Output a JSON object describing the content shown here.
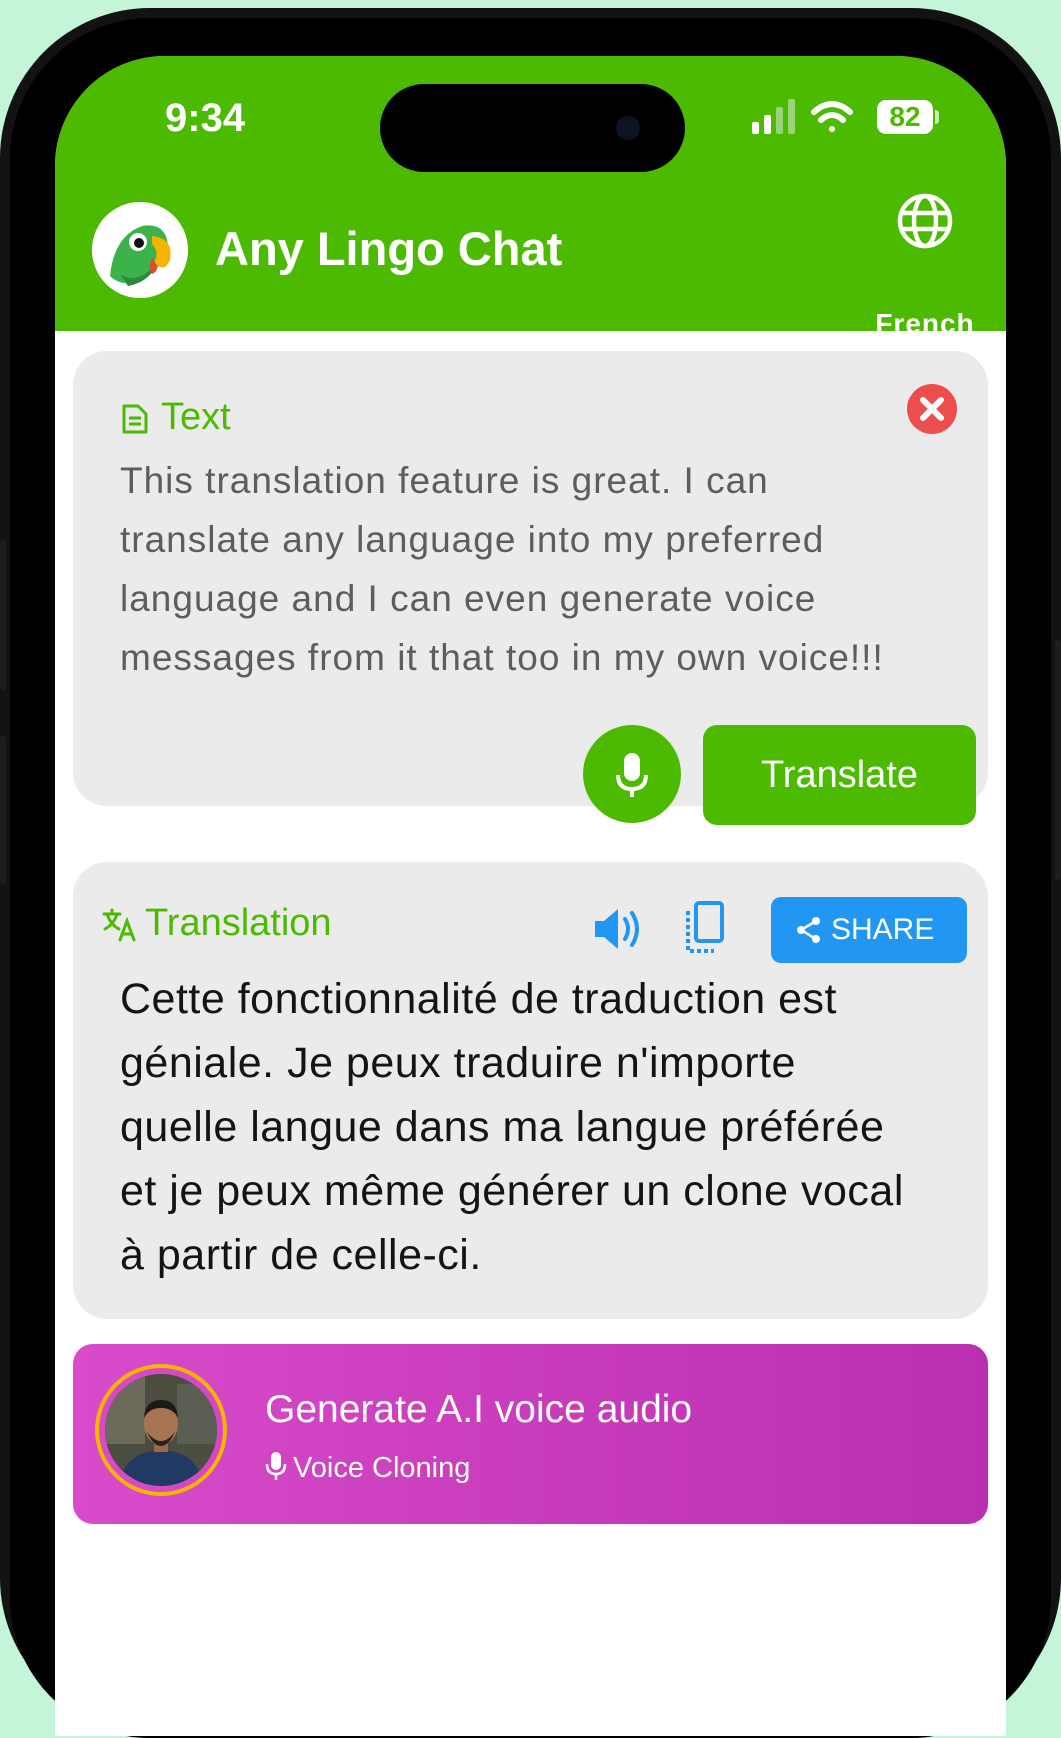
{
  "status_bar": {
    "time": "9:34",
    "battery": "82"
  },
  "header": {
    "title": "Any Lingo Chat",
    "language_label": "French"
  },
  "input_card": {
    "label": "Text",
    "text_lines": [
      "This translation feature is great. I can",
      "translate any language into my preferred",
      "language and I can even generate voice",
      "messages from it that too in my own voice!!!"
    ],
    "translate_label": "Translate"
  },
  "translation_card": {
    "label": "Translation",
    "share_label": "SHARE",
    "text_lines": [
      "Cette fonctionnalité de traduction est",
      "géniale. Je peux traduire n'importe",
      "quelle langue dans ma langue préférée",
      "et je peux même générer un clone vocal",
      "à partir de celle-ci."
    ]
  },
  "voice_card": {
    "title": "Generate A.I voice audio",
    "subtitle": "Voice Cloning"
  },
  "colors": {
    "brand_green": "#4cba00",
    "share_blue": "#2196f3",
    "voice_purple": "#c936bd",
    "close_red": "#ee4d4d"
  },
  "icons": [
    "parrot-logo",
    "globe-icon",
    "document-icon",
    "close-icon",
    "microphone-icon",
    "translate-icon",
    "speaker-icon",
    "copy-icon",
    "share-icon"
  ]
}
